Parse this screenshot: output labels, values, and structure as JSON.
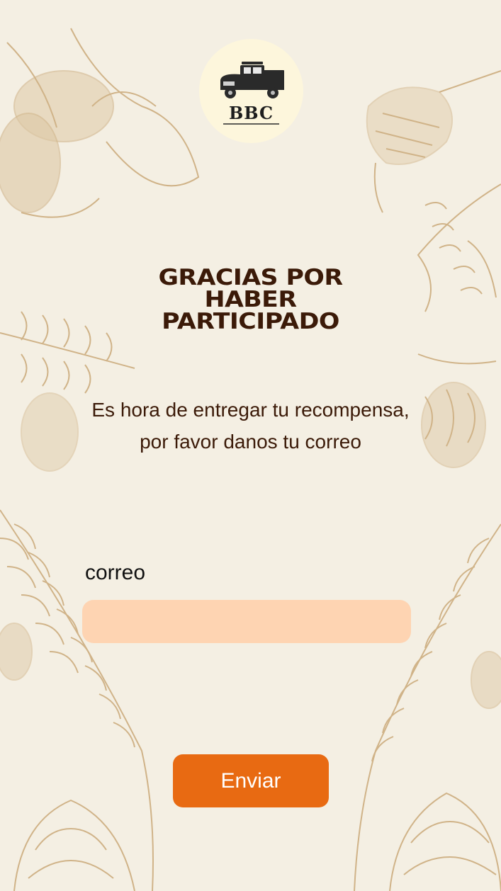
{
  "brand": {
    "logo_text": "BBC"
  },
  "heading": {
    "line1": "GRACIAS POR",
    "line2": "HABER",
    "line3": "PARTICIPADO"
  },
  "message": "Es hora de entregar tu recompensa, por favor danos tu correo",
  "form": {
    "email_label": "correo",
    "email_value": "",
    "email_placeholder": "",
    "submit_label": "Enviar"
  },
  "colors": {
    "background": "#f4efe3",
    "illustration": "#c9a878",
    "heading": "#3b1a08",
    "input_fill": "#fed4b2",
    "button": "#e86a12"
  }
}
